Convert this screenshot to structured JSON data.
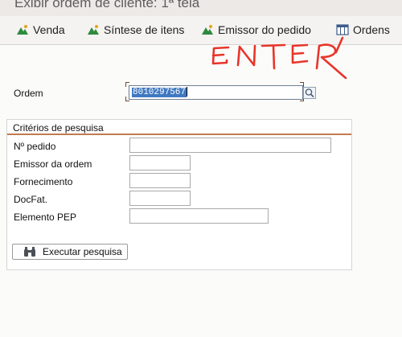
{
  "window": {
    "title": "Exibir ordem de cliente: 1ª tela"
  },
  "toolbar": {
    "items": [
      {
        "label": "Venda",
        "icon": "mountain-icon"
      },
      {
        "label": "Síntese de itens",
        "icon": "mountain-icon"
      },
      {
        "label": "Emissor do pedido",
        "icon": "mountain-icon"
      },
      {
        "label": "Ordens",
        "icon": "grid-icon"
      }
    ]
  },
  "form": {
    "ordem_label": "Ordem",
    "ordem_value": "8010297567"
  },
  "search": {
    "title": "Critérios de pesquisa",
    "fields": [
      {
        "label": "Nº pedido",
        "value": ""
      },
      {
        "label": "Emissor da ordem",
        "value": ""
      },
      {
        "label": "Fornecimento",
        "value": ""
      },
      {
        "label": "DocFat.",
        "value": ""
      },
      {
        "label": "Elemento PEP",
        "value": ""
      }
    ],
    "button_label": "Executar pesquisa",
    "button_icon": "binoculars-icon"
  },
  "annotation": {
    "text": "ENTER",
    "color": "#e8352a"
  },
  "colors": {
    "group_divider": "#c07a52",
    "selection": "#3f78c0",
    "icon_mountain": "#2d8a3e"
  }
}
